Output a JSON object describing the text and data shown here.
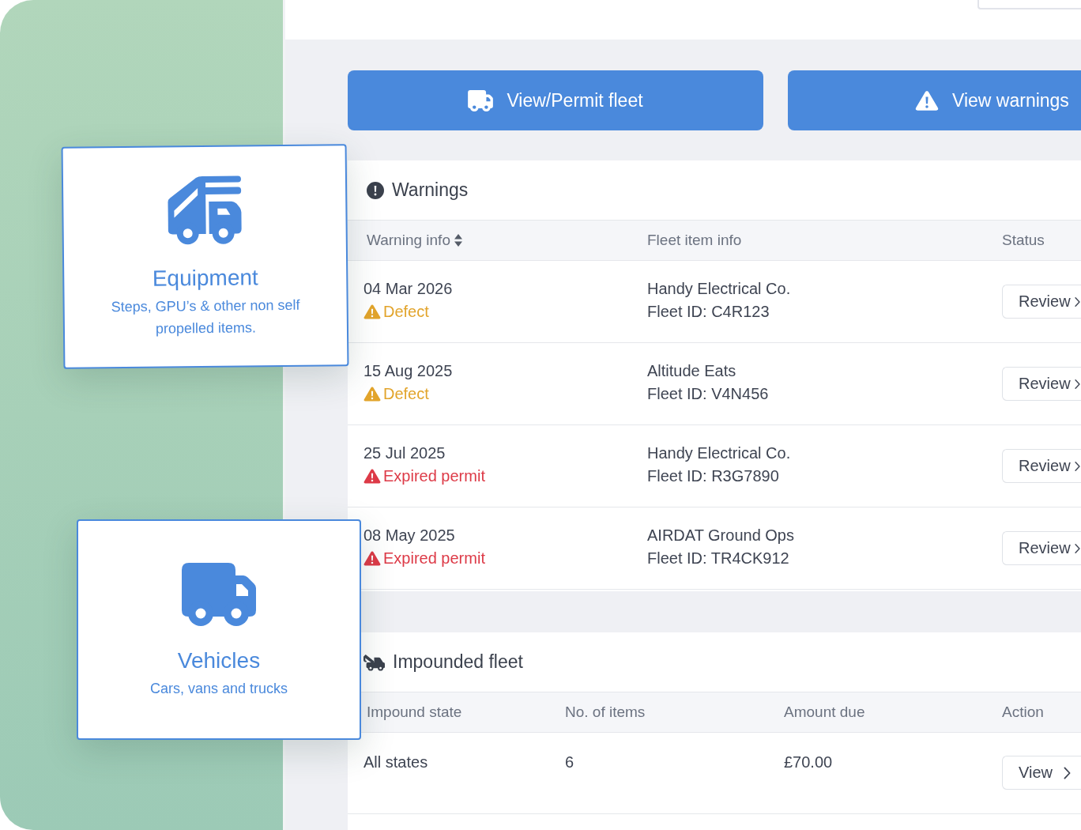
{
  "category_cards": [
    {
      "kind": "equipment",
      "title": "Equipment",
      "description": "Steps, GPU’s & other non self propelled items."
    },
    {
      "kind": "vehicles",
      "title": "Vehicles",
      "description": "Cars, vans and trucks"
    }
  ],
  "actions": [
    {
      "kind": "fleet",
      "label": "View/Permit fleet"
    },
    {
      "kind": "warnings",
      "label": "View warnings"
    }
  ],
  "warnings": {
    "title": "Warnings",
    "columns": [
      {
        "label": "Warning info",
        "sortable": true
      },
      {
        "label": "Fleet item info",
        "sortable": false
      },
      {
        "label": "Status",
        "sortable": false
      }
    ],
    "rows": [
      {
        "date": "04 Mar 2026",
        "warning": "Defect",
        "color": "#e2a42b",
        "company": "Handy Electrical Co.",
        "fleet_id": "Fleet ID: C4R123",
        "action": "Review"
      },
      {
        "date": "15 Aug 2025",
        "warning": "Defect",
        "color": "#e2a42b",
        "company": "Altitude Eats",
        "fleet_id": "Fleet ID: V4N456",
        "action": "Review"
      },
      {
        "date": "25 Jul 2025",
        "warning": "Expired permit",
        "color": "#dd3a47",
        "company": "Handy Electrical Co.",
        "fleet_id": "Fleet ID: R3G7890",
        "action": "Review"
      },
      {
        "date": "08 May 2025",
        "warning": "Expired permit",
        "color": "#dd3a47",
        "company": "AIRDAT Ground Ops",
        "fleet_id": "Fleet ID: TR4CK912",
        "action": "Review"
      }
    ]
  },
  "impounded_fleet": {
    "title": "Impounded fleet",
    "columns": [
      "Impound state",
      "No. of items",
      "Amount due",
      "Action"
    ],
    "rows": [
      {
        "state": "All states",
        "items": "6",
        "amount": "£70.00",
        "action": "View"
      }
    ]
  }
}
